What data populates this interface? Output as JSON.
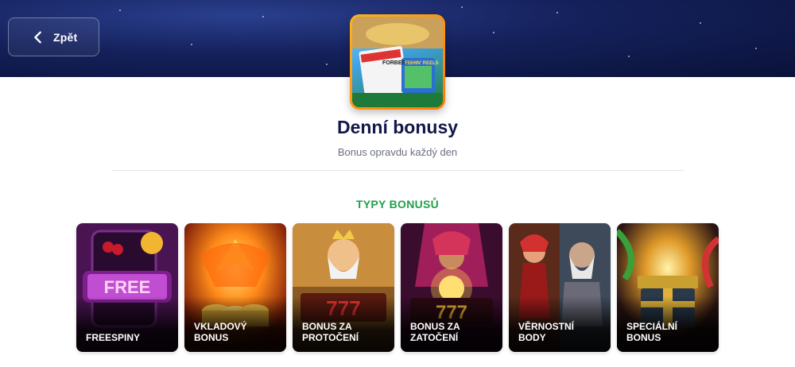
{
  "header": {
    "back_label": "Zpět"
  },
  "promo": {
    "thumbnail_caption": "FORBES",
    "thumbnail_game": "FISHIN' REELS",
    "title": "Denní bonusy",
    "subtitle": "Bonus opravdu každý den"
  },
  "types": {
    "heading": "TYPY BONUSŮ",
    "cards": [
      {
        "label": "FREESPINY",
        "badge": "FREE"
      },
      {
        "label": "VKLADOVÝ\nBONUS"
      },
      {
        "label": "BONUS ZA\nPROTOČENÍ",
        "badge": "777"
      },
      {
        "label": "BONUS ZA\nZATOČENÍ",
        "badge": "777"
      },
      {
        "label": "VĚRNOSTNÍ\nBODY"
      },
      {
        "label": "SPECIÁLNÍ\nBONUS"
      }
    ]
  },
  "colors": {
    "accent_green": "#22a04a",
    "title_navy": "#13184a",
    "thumb_border": "#ff9a0a"
  }
}
